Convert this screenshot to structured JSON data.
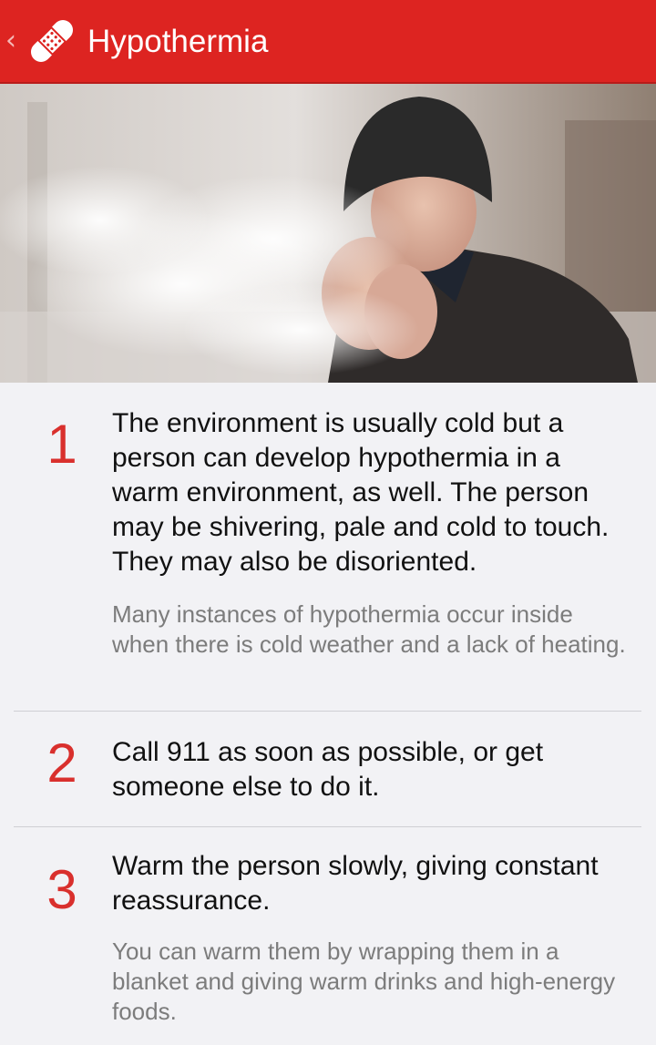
{
  "appbar": {
    "title": "Hypothermia",
    "back_glyph": "‹",
    "icon": "bandage-icon",
    "color": "#dd2421"
  },
  "hero": {
    "image": "photo of a man in a knit hat and sweater blowing warm breath into his cupped hands in cold weather"
  },
  "steps": [
    {
      "number": "1",
      "text": "The environment is usually cold but a person can develop hypothermia in a warm environment, as well. The person may be shivering, pale and cold to touch. They may also be disoriented.",
      "note": "Many instances of hypothermia occur inside when there is cold weather and a lack of heating."
    },
    {
      "number": "2",
      "text": "Call 911 as soon as possible, or get someone else to do it."
    },
    {
      "number": "3",
      "text": "Warm the person slowly, giving constant reassurance.",
      "note": "You can warm them by wrapping them in a blanket and giving warm drinks and high-energy foods."
    }
  ]
}
